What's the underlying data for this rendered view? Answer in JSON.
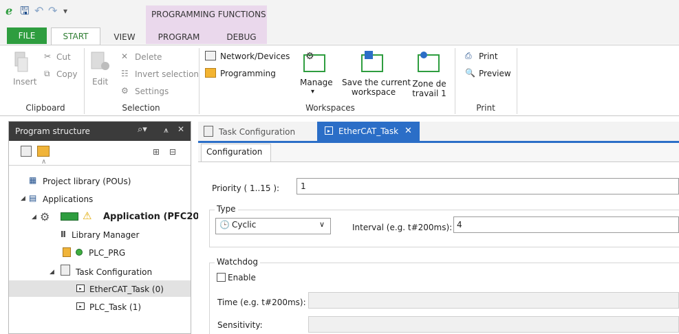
{
  "quick_access": {
    "context_tab_title": "PROGRAMMING FUNCTIONS"
  },
  "ribbon_tabs": {
    "file": "FILE",
    "start": "START",
    "view": "VIEW",
    "program": "PROGRAM",
    "debug": "DEBUG"
  },
  "clipboard": {
    "insert": "Insert",
    "cut": "Cut",
    "copy": "Copy",
    "group": "Clipboard"
  },
  "selection": {
    "edit": "Edit",
    "delete": "Delete",
    "invert": "Invert selection",
    "settings": "Settings",
    "group": "Selection"
  },
  "workspaces": {
    "network_devices": "Network/Devices",
    "programming": "Programming",
    "manage": "Manage",
    "save_line1": "Save the current",
    "save_line2": "workspace",
    "zone_line1": "Zone de",
    "zone_line2": "travail 1",
    "group": "Workspaces"
  },
  "print": {
    "print": "Print",
    "preview": "Preview",
    "group": "Print"
  },
  "program_structure": {
    "title": "Program structure",
    "items": {
      "project_library": "Project library (POUs)",
      "applications": "Applications",
      "application": "Application (PFC20",
      "library_manager": "Library Manager",
      "plc_prg": "PLC_PRG",
      "task_configuration": "Task Configuration",
      "ethercat_task": "EtherCAT_Task (0)",
      "plc_task": "PLC_Task (1)"
    }
  },
  "editor_tabs": {
    "task_configuration": "Task Configuration",
    "ethercat_task": "EtherCAT_Task"
  },
  "configuration": {
    "tab": "Configuration",
    "priority_label": "Priority ( 1..15 ):",
    "priority_value": "1",
    "type_group": "Type",
    "type_value": "Cyclic",
    "interval_label": "Interval (e.g. t#200ms):",
    "interval_value": "4",
    "watchdog_group": "Watchdog",
    "enable_label": "Enable",
    "enable_checked": false,
    "time_label": "Time (e.g. t#200ms):",
    "sensitivity_label": "Sensitivity:"
  },
  "colors": {
    "file_tab": "#2e9d3f",
    "context_tab": "#ead8ec",
    "active_editor_tab": "#2b6ec7",
    "panel_header": "#3b3b3b"
  }
}
